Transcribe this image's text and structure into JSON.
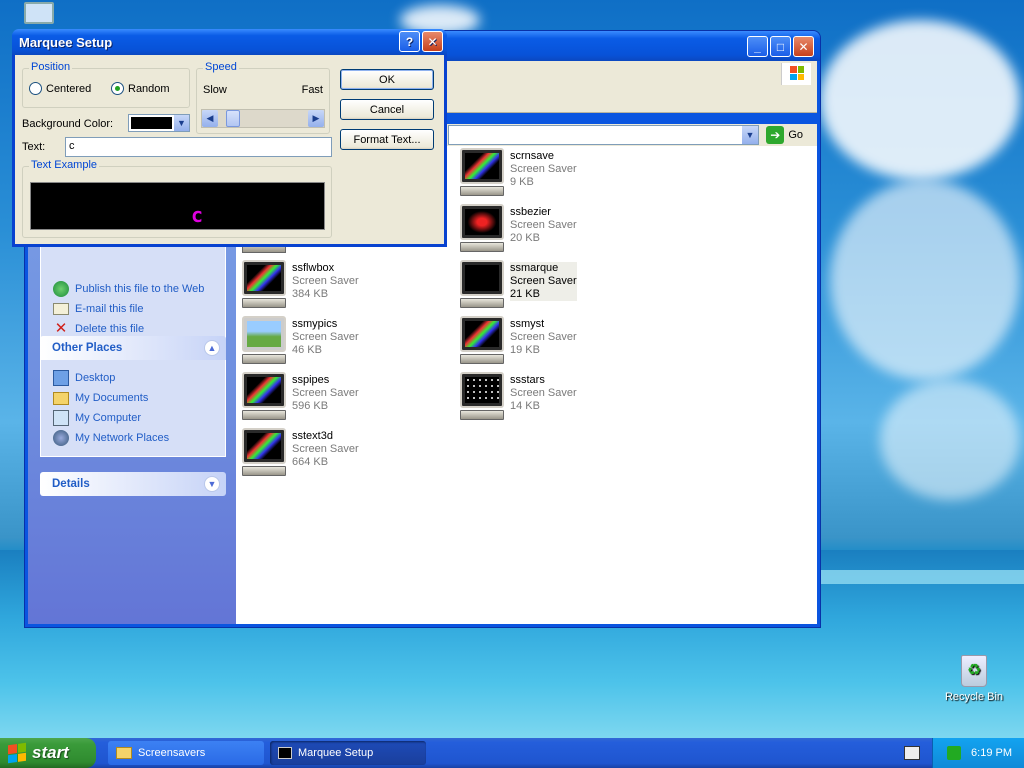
{
  "dialog": {
    "title": "Marquee Setup",
    "help_label": "?",
    "close_label": "✕",
    "position_legend": "Position",
    "centered_label": "Centered",
    "random_label": "Random",
    "speed_legend": "Speed",
    "slow_label": "Slow",
    "fast_label": "Fast",
    "ok_label": "OK",
    "cancel_label": "Cancel",
    "format_label": "Format Text...",
    "bgcolor_label": "Background Color:",
    "text_label": "Text:",
    "text_value": "c",
    "example_legend": "Text Example",
    "preview_text": "c",
    "preview_color": "#e000e0",
    "bg_color": "#000000"
  },
  "explorer": {
    "go_label": "Go",
    "file_tasks": [
      {
        "label": "Publish this file to the Web"
      },
      {
        "label": "E-mail this file"
      },
      {
        "label": "Delete this file"
      }
    ],
    "other_places": {
      "title": "Other Places",
      "items": [
        {
          "label": "Desktop"
        },
        {
          "label": "My Documents"
        },
        {
          "label": "My Computer"
        },
        {
          "label": "My Network Places"
        }
      ]
    },
    "details": {
      "title": "Details"
    },
    "files": [
      {
        "name": "scrnsave",
        "type": "Screen Saver",
        "size": "9 KB"
      },
      {
        "name": "ssbezier",
        "type": "Screen Saver",
        "size": "20 KB"
      },
      {
        "name": "ssflwbox",
        "type": "Screen Saver",
        "size": "384 KB"
      },
      {
        "name": "ssmarque",
        "type": "Screen Saver",
        "size": "21 KB"
      },
      {
        "name": "ssmypics",
        "type": "Screen Saver",
        "size": "46 KB"
      },
      {
        "name": "ssmyst",
        "type": "Screen Saver",
        "size": "19 KB"
      },
      {
        "name": "sspipes",
        "type": "Screen Saver",
        "size": "596 KB"
      },
      {
        "name": "ssstars",
        "type": "Screen Saver",
        "size": "14 KB"
      },
      {
        "name": "sstext3d",
        "type": "Screen Saver",
        "size": "664 KB"
      }
    ]
  },
  "desktop": {
    "recycle_bin": "Recycle Bin"
  },
  "taskbar": {
    "start_label": "start",
    "tasks": [
      {
        "label": "Screensavers"
      },
      {
        "label": "Marquee Setup"
      }
    ],
    "clock": "6:19 PM"
  }
}
